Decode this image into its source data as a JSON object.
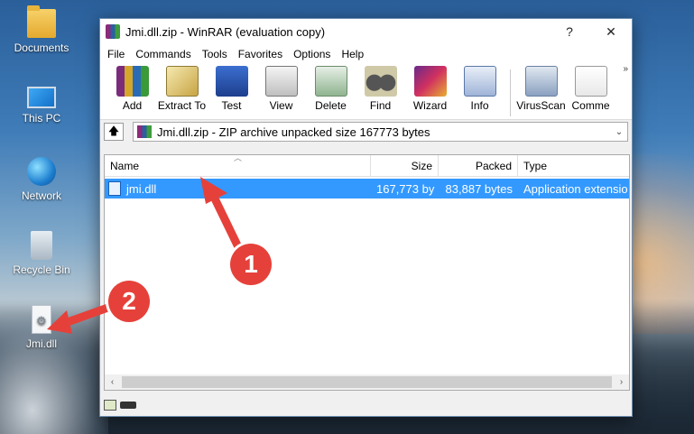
{
  "desktop": {
    "icons": [
      {
        "label": "Documents"
      },
      {
        "label": "This PC"
      },
      {
        "label": "Network"
      },
      {
        "label": "Recycle Bin"
      },
      {
        "label": "Jmi.dll"
      }
    ]
  },
  "window": {
    "title": "Jmi.dll.zip - WinRAR (evaluation copy)",
    "help_btn": "?",
    "close_btn": "✕"
  },
  "menu": [
    "File",
    "Commands",
    "Tools",
    "Favorites",
    "Options",
    "Help"
  ],
  "toolbar": {
    "tools": [
      "Add",
      "Extract To",
      "Test",
      "View",
      "Delete",
      "Find",
      "Wizard",
      "Info",
      "VirusScan",
      "Comme"
    ],
    "more": "»"
  },
  "address": {
    "up": "🡅",
    "path": "Jmi.dll.zip - ZIP archive unpacked size 167773 bytes",
    "chevron": "⌄"
  },
  "list": {
    "columns": [
      "Name",
      "Size",
      "Packed",
      "Type"
    ],
    "rows": [
      {
        "name": "jmi.dll",
        "size": "167,773 by",
        "packed": "83,887 bytes",
        "type": "Application extensio"
      }
    ],
    "scroll_left": "‹",
    "scroll_right": "›"
  },
  "annotations": {
    "badge1": "1",
    "badge2": "2",
    "color": "#e5413a"
  }
}
